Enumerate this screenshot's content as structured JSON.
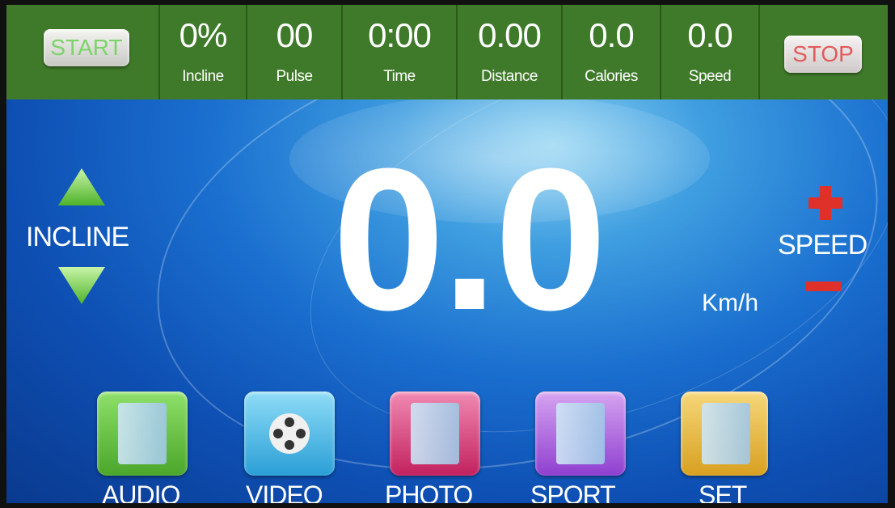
{
  "buttons": {
    "start": "START",
    "stop": "STOP"
  },
  "metrics": [
    {
      "value": "0%",
      "label": "Incline"
    },
    {
      "value": "00",
      "label": "Pulse"
    },
    {
      "value": "0:00",
      "label": "Time"
    },
    {
      "value": "0.00",
      "label": "Distance"
    },
    {
      "value": "0.0",
      "label": "Calories"
    },
    {
      "value": "0.0",
      "label": "Speed"
    }
  ],
  "main": {
    "speed_value": "0.0",
    "unit": "Km/h"
  },
  "incline_control": {
    "label": "INCLINE",
    "up_icon": "triangle-up",
    "down_icon": "triangle-down"
  },
  "speed_control": {
    "label": "SPEED",
    "plus_icon": "plus",
    "minus_icon": "minus"
  },
  "apps": [
    {
      "label": "AUDIO",
      "icon": "audio-folder-icon",
      "color": "#6bbf3a"
    },
    {
      "label": "VIDEO",
      "icon": "video-reel-icon",
      "color": "#3fb6e6"
    },
    {
      "label": "PHOTO",
      "icon": "photo-folder-icon",
      "color": "#d63a7a"
    },
    {
      "label": "SPORT",
      "icon": "sport-folder-icon",
      "color": "#a75ad6"
    },
    {
      "label": "SET",
      "icon": "settings-folder-icon",
      "color": "#e2b23a"
    }
  ],
  "colors": {
    "top_bar": "#3f7a2a",
    "accent_green": "#7cd36a",
    "accent_red": "#e25a5a",
    "background_blue": "#1a6fcf"
  }
}
